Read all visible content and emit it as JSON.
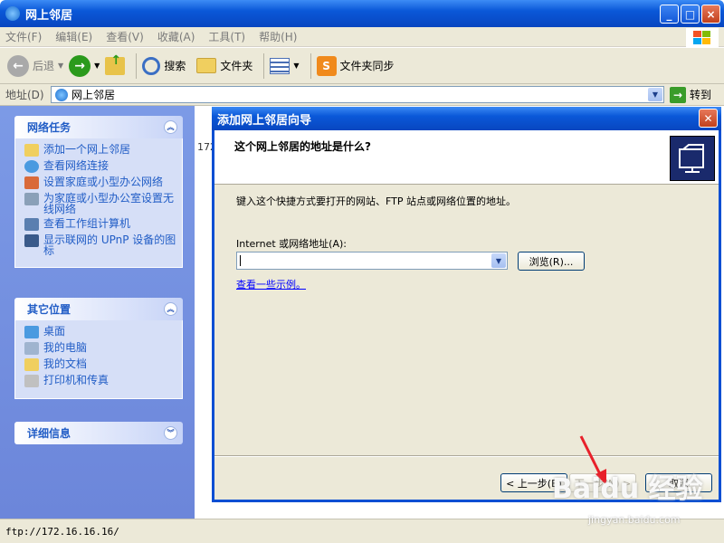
{
  "window": {
    "title": "网上邻居",
    "min": "_",
    "max": "□",
    "close": "×"
  },
  "menubar": [
    "文件(F)",
    "编辑(E)",
    "查看(V)",
    "收藏(A)",
    "工具(T)",
    "帮助(H)"
  ],
  "toolbar": {
    "back": "后退",
    "search": "搜索",
    "folders": "文件夹",
    "sync": "文件夹同步"
  },
  "address": {
    "label": "地址(D)",
    "value": "网上邻居",
    "go": "转到"
  },
  "tasks": {
    "title": "网络任务",
    "items": [
      "添加一个网上邻居",
      "查看网络连接",
      "设置家庭或小型办公网络",
      "为家庭或小型办公室设置无线网络",
      "查看工作组计算机",
      "显示联网的 UPnP 设备的图标"
    ]
  },
  "places": {
    "title": "其它位置",
    "items": [
      "桌面",
      "我的电脑",
      "我的文档",
      "打印机和传真"
    ]
  },
  "details": {
    "title": "详细信息"
  },
  "content": {
    "partial_text": "172"
  },
  "statusbar": {
    "text": "ftp://172.16.16.16/"
  },
  "dialog": {
    "title": "添加网上邻居向导",
    "header": "这个网上邻居的地址是什么?",
    "instruction": "键入这个快捷方式要打开的网站、FTP 站点或网络位置的地址。",
    "field_label": "Internet 或网络地址(A):",
    "field_value": "",
    "browse": "浏览(R)...",
    "examples_link": "查看一些示例。",
    "back": "< 上一步(B)",
    "next": "下一步(N) >",
    "cancel": "取消"
  },
  "watermark": {
    "brand": "Baidu 经验",
    "url": "jingyan.baidu.com"
  },
  "colors": {
    "xp_blue": "#0a58d8",
    "taskpane": "#6c86da",
    "link": "#215dc6",
    "annotation": "#e8202a"
  }
}
